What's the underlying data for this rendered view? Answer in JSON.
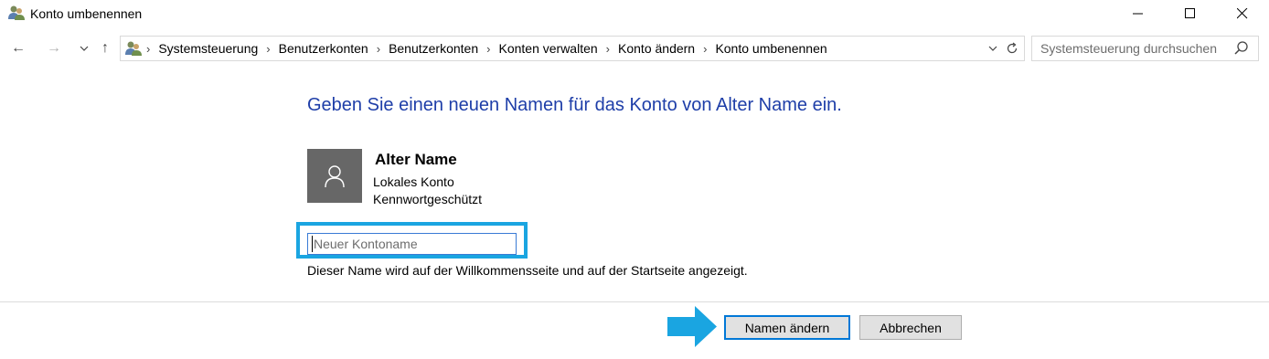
{
  "window": {
    "title": "Konto umbenennen",
    "controls": {
      "minimize": "–",
      "maximize": "☐",
      "close": "✕"
    }
  },
  "nav": {
    "back": "←",
    "forward": "→",
    "recent": "⌄",
    "up": "↑"
  },
  "address": {
    "breadcrumbs": [
      "Systemsteuerung",
      "Benutzerkonten",
      "Benutzerkonten",
      "Konten verwalten",
      "Konto ändern",
      "Konto umbenennen"
    ],
    "separator": "›"
  },
  "search": {
    "placeholder": "Systemsteuerung durchsuchen"
  },
  "main": {
    "heading": "Geben Sie einen neuen Namen für das Konto von Alter Name ein.",
    "account": {
      "name": "Alter Name",
      "type": "Lokales Konto",
      "protection": "Kennwortgeschützt"
    },
    "input": {
      "placeholder": "Neuer Kontoname",
      "value": ""
    },
    "hint": "Dieser Name wird auf der Willkommensseite und auf der Startseite angezeigt."
  },
  "footer": {
    "rename_label": "Namen ändern",
    "cancel_label": "Abbrechen"
  },
  "colors": {
    "heading": "#1e3ea8",
    "highlight": "#1aa5e1",
    "arrow": "#1aa5e1",
    "avatar_bg": "#676767"
  },
  "icons": {
    "app": "users-icon",
    "avatar": "user-icon",
    "search": "search-icon",
    "refresh": "refresh-icon",
    "dropdown": "chevron-down-icon"
  }
}
